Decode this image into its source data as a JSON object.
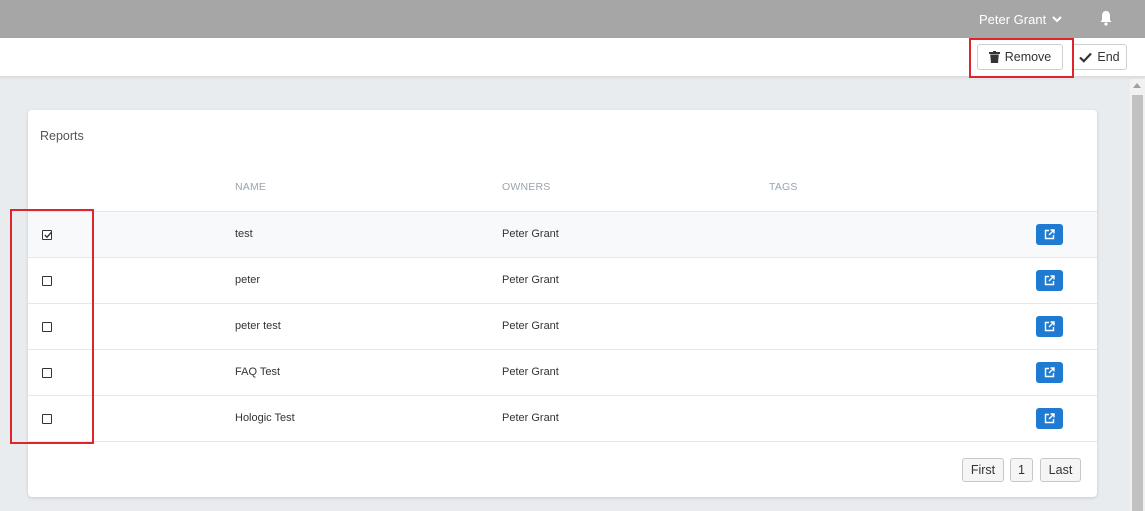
{
  "header": {
    "user_name": "Peter Grant",
    "user_menu_icon": "chevron-down-icon",
    "notifications_icon": "bell-icon"
  },
  "toolbar": {
    "remove_label": "Remove",
    "remove_icon": "trash-icon",
    "end_label": "End",
    "end_icon": "check-icon"
  },
  "reports": {
    "title": "Reports",
    "columns": [
      "NAME",
      "OWNERS",
      "TAGS"
    ],
    "rows": [
      {
        "checked": true,
        "name": "test",
        "owner": "Peter Grant",
        "tags": ""
      },
      {
        "checked": false,
        "name": "peter",
        "owner": "Peter Grant",
        "tags": ""
      },
      {
        "checked": false,
        "name": "peter test",
        "owner": "Peter Grant",
        "tags": ""
      },
      {
        "checked": false,
        "name": "FAQ Test",
        "owner": "Peter Grant",
        "tags": ""
      },
      {
        "checked": false,
        "name": "Hologic Test",
        "owner": "Peter Grant",
        "tags": ""
      }
    ],
    "row_action_icon": "external-link-icon"
  },
  "pagination": {
    "first_label": "First",
    "page_label": "1",
    "last_label": "Last"
  },
  "colors": {
    "topbar": "#a6a6a6",
    "accent": "#1f7bd1",
    "highlight": "#e0242b"
  }
}
